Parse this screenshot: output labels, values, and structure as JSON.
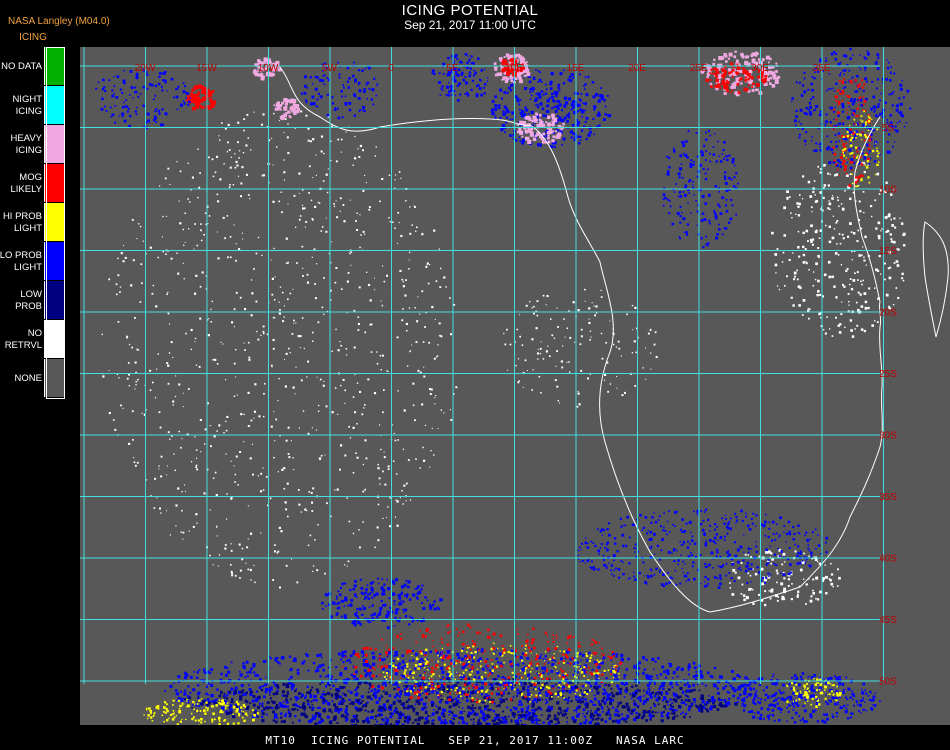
{
  "header": {
    "source": "NASA Langley (M04.0)",
    "product": "ICING",
    "title": "ICING POTENTIAL",
    "subtitle": "Sep 21, 2017 11:00 UTC"
  },
  "legend": [
    {
      "label": "NO DATA",
      "color": "#00b000"
    },
    {
      "label": "NIGHT\nICING",
      "color": "#00ffff"
    },
    {
      "label": "HEAVY\nICING",
      "color": "#f0a8e0"
    },
    {
      "label": "MOG\nLIKELY",
      "color": "#ff0000"
    },
    {
      "label": "HI PROB\nLIGHT",
      "color": "#ffff00"
    },
    {
      "label": "LO PROB\nLIGHT",
      "color": "#0000ff"
    },
    {
      "label": "LOW\nPROB",
      "color": "#000080"
    },
    {
      "label": "NO\nRETRVL",
      "color": "#ffffff"
    },
    {
      "label": "NONE",
      "color": "#585858"
    }
  ],
  "map": {
    "background": "#585858",
    "grid_color": "#40e0e0",
    "label_color": "#c00000",
    "lon_labels": [
      "20W",
      "15W",
      "10W",
      "5W",
      "0",
      "5E",
      "10E",
      "15E",
      "20E",
      "25E",
      "30E",
      "35E"
    ],
    "lat_labels": [
      "5S",
      "10S",
      "15S",
      "20S",
      "25S",
      "30S",
      "35S",
      "40S",
      "45S",
      "50S"
    ]
  },
  "footer": "MT10  ICING POTENTIAL   SEP 21, 2017 11:00Z   NASA LARC"
}
